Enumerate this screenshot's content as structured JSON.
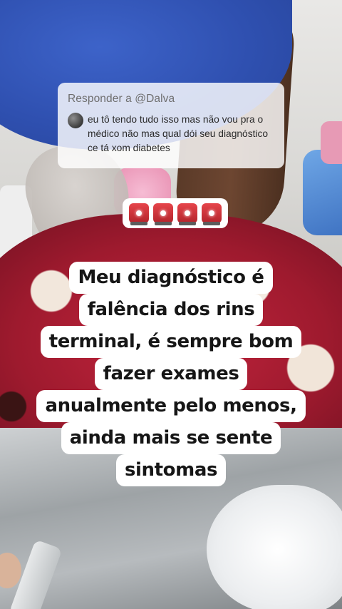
{
  "reply": {
    "header": "Responder a @Dalva",
    "comment": "eu tô tendo tudo isso mas não  vou pra o médico não  mas qual dói seu diagnóstico ce tá xom diabetes"
  },
  "alarm": {
    "icons": [
      "rotating-light-icon",
      "rotating-light-icon",
      "rotating-light-icon",
      "rotating-light-icon"
    ]
  },
  "caption": {
    "lines": [
      "Meu diagnóstico é",
      "falência dos rins",
      "terminal, é sempre bom",
      "fazer exames",
      "anualmente pelo menos,",
      "ainda mais se sente",
      "sintomas"
    ]
  }
}
